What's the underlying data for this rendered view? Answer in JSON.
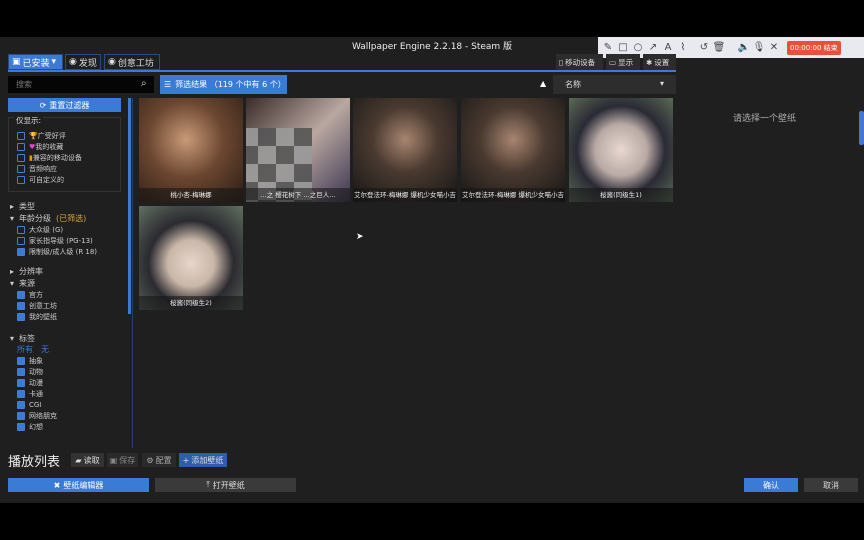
{
  "window": {
    "title": "Wallpaper Engine 2.2.18 - Steam 版"
  },
  "nav_tabs": [
    {
      "label": "已安装",
      "icon": "save-icon"
    },
    {
      "label": "发现",
      "icon": "compass-icon"
    },
    {
      "label": "创意工坊",
      "icon": "steam-icon"
    }
  ],
  "right_tabs": [
    {
      "label": "移动设备",
      "icon": "phone-icon"
    },
    {
      "label": "显示",
      "icon": "monitor-icon"
    },
    {
      "label": "设置",
      "icon": "gear-icon"
    }
  ],
  "search": {
    "placeholder": "搜索"
  },
  "filter_results": "筛选结果 （119 个中有 6 个）",
  "sort": {
    "selected": "名称"
  },
  "sidebar": {
    "reset_label": "重置过滤器",
    "show_only_label": "仅显示:",
    "show_only": [
      {
        "label": "广受好评",
        "checked": false
      },
      {
        "label": "我的收藏",
        "checked": false
      },
      {
        "label": "兼容的移动设备",
        "checked": false
      },
      {
        "label": "音频响应",
        "checked": false
      },
      {
        "label": "可自定义的",
        "checked": false
      }
    ],
    "type_label": "类型",
    "age_label": "年龄分级",
    "age_badge": "(已筛选)",
    "age": [
      {
        "label": "大众级 (G)",
        "checked": false
      },
      {
        "label": "家长指导级 (PG-13)",
        "checked": false
      },
      {
        "label": "限制级/成人级 (R 18)",
        "checked": true
      }
    ],
    "resolution_label": "分辨率",
    "source_label": "来源",
    "source": [
      {
        "label": "官方",
        "checked": true
      },
      {
        "label": "创意工坊",
        "checked": true
      },
      {
        "label": "我的壁纸",
        "checked": true
      }
    ],
    "tags_label": "标签",
    "all": "所有",
    "none": "无",
    "tags": [
      {
        "label": "抽象",
        "checked": true
      },
      {
        "label": "动物",
        "checked": true
      },
      {
        "label": "动漫",
        "checked": true
      },
      {
        "label": "卡通",
        "checked": true
      },
      {
        "label": "CGI",
        "checked": true
      },
      {
        "label": "网络朋克",
        "checked": true
      },
      {
        "label": "幻想",
        "checked": true
      }
    ]
  },
  "wallpapers": [
    {
      "title": "桃小杏-梅琳娜"
    },
    {
      "title": "…之 樱花树下 …之巨人…"
    },
    {
      "title": "艾尔登法环-梅琳娜 爆机少女喵小吉"
    },
    {
      "title": "艾尔登法环-梅琳娜 爆机少女喵小吉"
    },
    {
      "title": "桜酱(同级生1)"
    },
    {
      "title": "桜酱(同级生2)"
    }
  ],
  "right_panel": {
    "placeholder": "请选择一个壁纸"
  },
  "playlist": {
    "title": "播放列表",
    "load": "读取",
    "save": "保存",
    "config": "配置",
    "add": "添加壁纸"
  },
  "footer": {
    "editor": "壁纸编辑器",
    "open": "打开壁纸",
    "ok": "确认",
    "cancel": "取消"
  },
  "recorder": {
    "timer": "00:00:00 结束",
    "tools": [
      "pencil-icon",
      "rectangle-icon",
      "circle-icon",
      "arrow-icon",
      "text-icon",
      "highlighter-icon",
      "undo-icon",
      "trash-icon",
      "speaker-icon",
      "mic-icon",
      "close-icon"
    ]
  },
  "colors": {
    "accent": "#3a7bd5",
    "background": "#1f1f1f",
    "record": "#e8503a"
  }
}
